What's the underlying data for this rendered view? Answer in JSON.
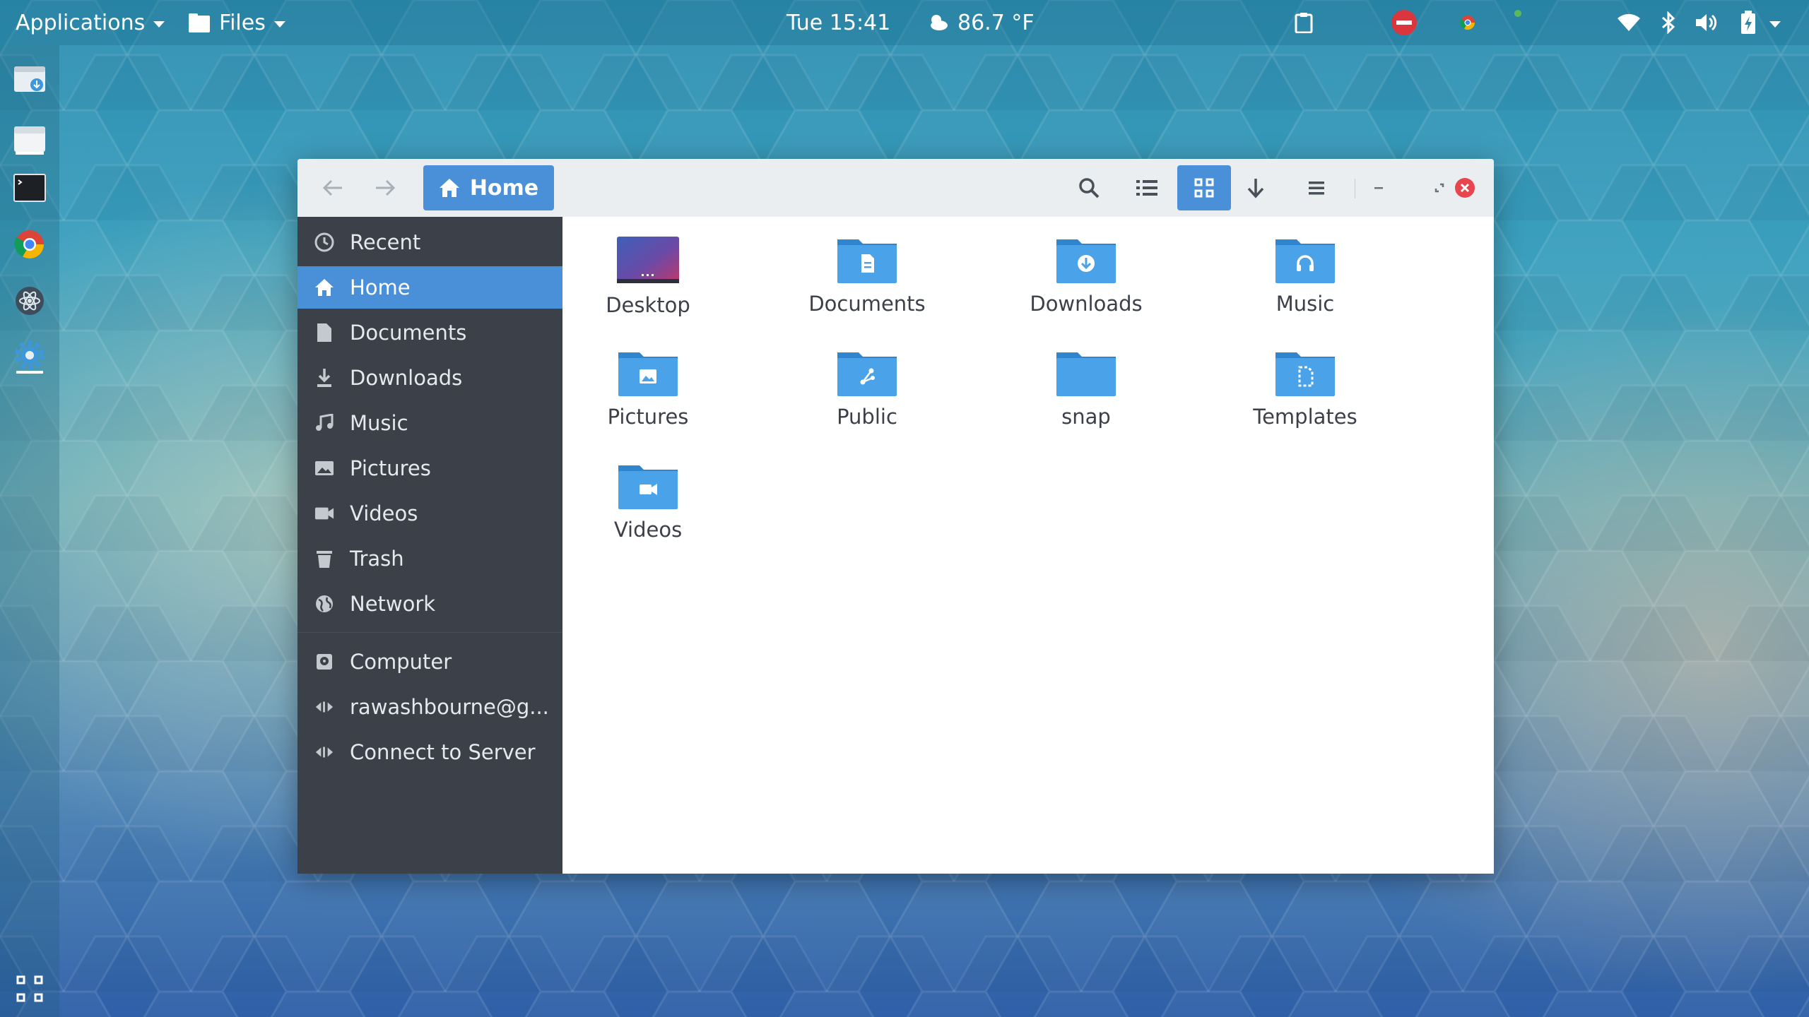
{
  "topbar": {
    "applications": "Applications",
    "files_menu": "Files",
    "clock": "Tue 15:41",
    "weather": "86.7 °F"
  },
  "dock": {
    "items": [
      "downloader-icon",
      "files-icon",
      "terminal-icon",
      "chrome-icon",
      "atom-icon",
      "settings-icon"
    ]
  },
  "window": {
    "path_button": "Home",
    "sidebar": {
      "items": [
        {
          "label": "Recent",
          "icon": "clock-icon"
        },
        {
          "label": "Home",
          "icon": "home-icon",
          "active": true
        },
        {
          "label": "Documents",
          "icon": "document-icon"
        },
        {
          "label": "Downloads",
          "icon": "download-icon"
        },
        {
          "label": "Music",
          "icon": "music-icon"
        },
        {
          "label": "Pictures",
          "icon": "picture-icon"
        },
        {
          "label": "Videos",
          "icon": "video-icon"
        },
        {
          "label": "Trash",
          "icon": "trash-icon"
        },
        {
          "label": "Network",
          "icon": "network-icon"
        },
        {
          "label": "Computer",
          "icon": "computer-icon"
        },
        {
          "label": "rawashbourne@g...",
          "icon": "remote-icon"
        },
        {
          "label": "Connect to Server",
          "icon": "server-icon"
        }
      ]
    },
    "files": [
      {
        "name": "Desktop",
        "icon": "desktop-folder-icon"
      },
      {
        "name": "Documents",
        "icon": "documents-folder-icon"
      },
      {
        "name": "Downloads",
        "icon": "downloads-folder-icon"
      },
      {
        "name": "Music",
        "icon": "music-folder-icon"
      },
      {
        "name": "Pictures",
        "icon": "pictures-folder-icon"
      },
      {
        "name": "Public",
        "icon": "public-folder-icon"
      },
      {
        "name": "snap",
        "icon": "folder-icon"
      },
      {
        "name": "Templates",
        "icon": "templates-folder-icon"
      },
      {
        "name": "Videos",
        "icon": "videos-folder-icon"
      }
    ]
  },
  "colors": {
    "accent": "#4a90d9",
    "sidebar_bg": "#3c4049",
    "folder": "#3d97dc",
    "close": "#e9454f"
  }
}
